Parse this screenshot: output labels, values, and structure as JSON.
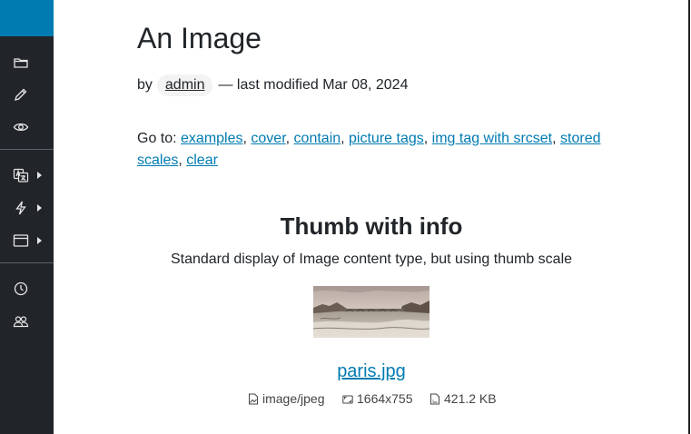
{
  "page": {
    "title": "An Image",
    "byline": {
      "by": "by",
      "author": "admin",
      "modified": "— last modified Mar 08, 2024"
    },
    "goto": {
      "prefix": "Go to: ",
      "links": [
        "examples",
        "cover",
        "contain",
        "picture tags",
        "img tag with srcset",
        "stored scales",
        "clear"
      ]
    },
    "section": {
      "title": "Thumb with info",
      "subtitle": "Standard display of Image content type, but using thumb scale"
    },
    "file": {
      "name": "paris.jpg",
      "mimetype": "image/jpeg",
      "dimensions": "1664x755",
      "size": "421.2 KB"
    }
  },
  "sidebar": {
    "items": [
      {
        "icon": "folder-icon",
        "caret": false
      },
      {
        "icon": "pencil-icon",
        "caret": false
      },
      {
        "icon": "eye-icon",
        "caret": false
      },
      {
        "icon": "translate-icon",
        "caret": true
      },
      {
        "icon": "lightning-icon",
        "caret": true
      },
      {
        "icon": "window-icon",
        "caret": true
      },
      {
        "icon": "clock-icon",
        "caret": false
      },
      {
        "icon": "people-icon",
        "caret": false
      }
    ]
  },
  "colors": {
    "sidebar_bg": "#212529",
    "brand": "#007bb1",
    "link": "#007bb1"
  }
}
